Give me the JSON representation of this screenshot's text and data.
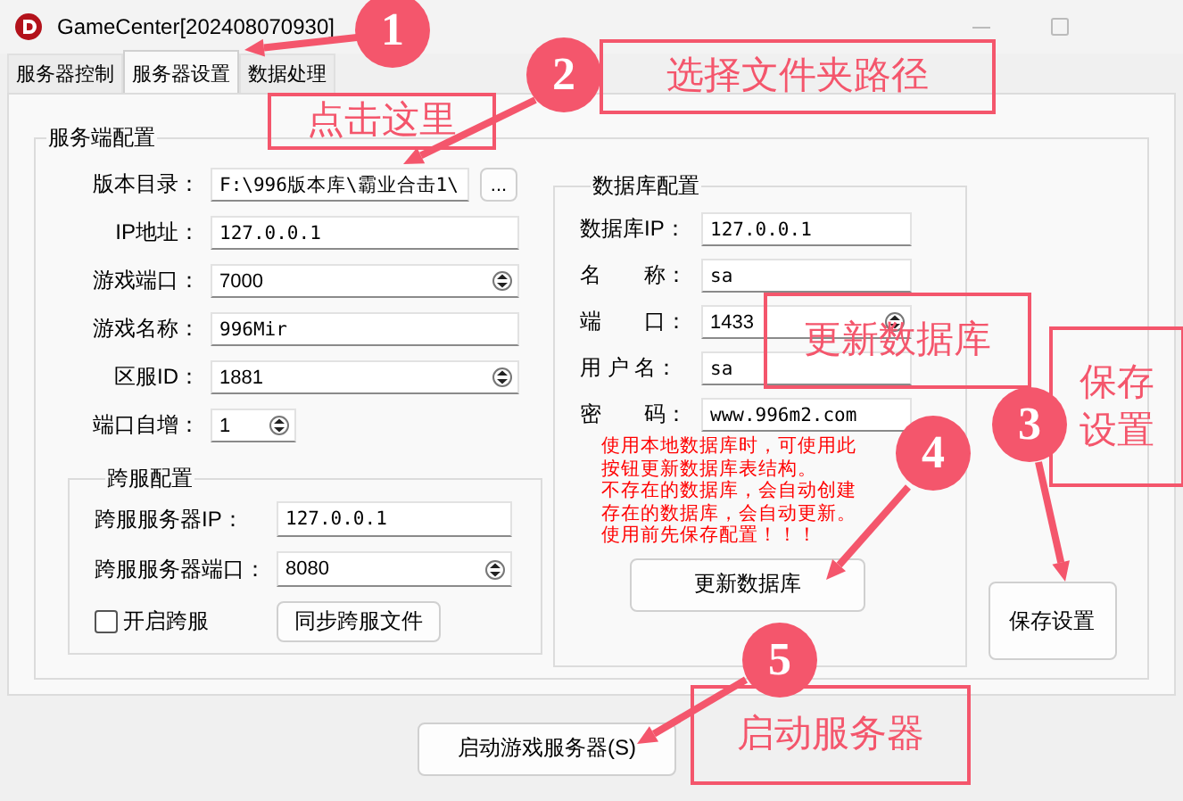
{
  "window": {
    "title": "GameCenter[202408070930]"
  },
  "tabs": [
    {
      "label": "服务器控制",
      "selected": false
    },
    {
      "label": "服务器设置",
      "selected": true
    },
    {
      "label": "数据处理",
      "selected": false
    }
  ],
  "server_group": {
    "title": "服务端配置",
    "fields": [
      {
        "label": "版本目录：",
        "value": "F:\\996版本库\\霸业合击1\\",
        "kind": "browse",
        "browse_label": "..."
      },
      {
        "label": "IP地址：",
        "value": "127.0.0.1",
        "kind": "text"
      },
      {
        "label": "游戏端口：",
        "value": "7000",
        "kind": "spin"
      },
      {
        "label": "游戏名称：",
        "value": "996Mir",
        "kind": "text"
      },
      {
        "label": "区服ID：",
        "value": "1881",
        "kind": "spin"
      },
      {
        "label": "端口自增：",
        "value": "1",
        "kind": "small_spin"
      }
    ]
  },
  "cross_group": {
    "title": "跨服配置",
    "fields": [
      {
        "label": "跨服服务器IP：",
        "value": "127.0.0.1",
        "kind": "text"
      },
      {
        "label": "跨服服务器端口：",
        "value": "8080",
        "kind": "spin"
      }
    ],
    "checkbox": {
      "label": "开启跨服",
      "checked": false
    },
    "sync_button": "同步跨服文件"
  },
  "db_group": {
    "title": "数据库配置",
    "fields": [
      {
        "label": "数据库IP：",
        "value": "127.0.0.1",
        "kind": "text"
      },
      {
        "label": "名　　称：",
        "value": "sa",
        "kind": "text"
      },
      {
        "label": "端　　口：",
        "value": "1433",
        "kind": "spin"
      },
      {
        "label": "用 户 名：",
        "value": "sa",
        "kind": "text"
      },
      {
        "label": "密　　码：",
        "value": "www.996m2.com",
        "kind": "text"
      }
    ],
    "note_lines": [
      "使用本地数据库时，可使用此",
      "按钮更新数据库表结构。",
      "不存在的数据库，会自动创建",
      "存在的数据库，会自动更新。",
      "使用前先保存配置！！！"
    ],
    "update_button": "更新数据库"
  },
  "save_button": "保存设置",
  "start_button": "启动游戏服务器(S)",
  "annotations": [
    {
      "number": "1",
      "callout": "点击这里"
    },
    {
      "number": "2",
      "callout": "选择文件夹路径"
    },
    {
      "number": "4",
      "callout": "更新数据库"
    },
    {
      "number": "3",
      "callout": "保存设置"
    },
    {
      "number": "5",
      "callout": "启动服务器"
    }
  ]
}
